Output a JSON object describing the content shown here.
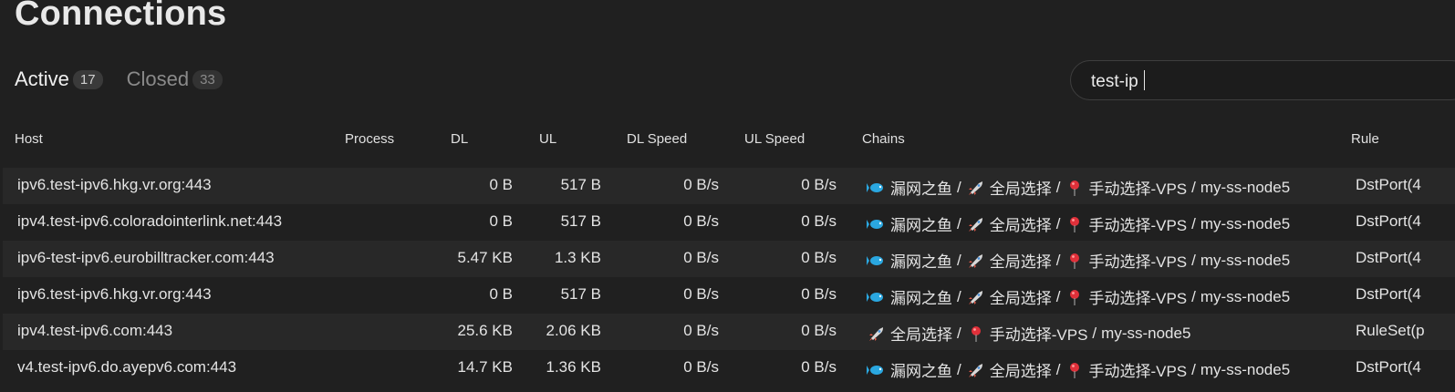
{
  "page": {
    "title": "Connections"
  },
  "tabs": [
    {
      "label": "Active",
      "count": "17"
    },
    {
      "label": "Closed",
      "count": "33"
    }
  ],
  "search": {
    "value": "test-ip",
    "placeholder": ""
  },
  "table": {
    "columns": [
      "Host",
      "Process",
      "DL",
      "UL",
      "DL Speed",
      "UL Speed",
      "Chains",
      "Rule"
    ],
    "rows": [
      {
        "host": "ipv6.test-ipv6.hkg.vr.org:443",
        "dl": "0 B",
        "ul": "517 B",
        "dl_speed": "0 B/s",
        "ul_speed": "0 B/s",
        "rule": "DstPort(4",
        "chain": [
          {
            "icon": "fish-icon",
            "label": "漏网之鱼"
          },
          {
            "icon": "rocket-icon",
            "label": "全局选择"
          },
          {
            "icon": "pin-icon",
            "label": "手动选择-VPS"
          },
          {
            "icon": "",
            "label": "my-ss-node5"
          }
        ]
      },
      {
        "host": "ipv4.test-ipv6.coloradointerlink.net:443",
        "dl": "0 B",
        "ul": "517 B",
        "dl_speed": "0 B/s",
        "ul_speed": "0 B/s",
        "rule": "DstPort(4",
        "chain": [
          {
            "icon": "fish-icon",
            "label": "漏网之鱼"
          },
          {
            "icon": "rocket-icon",
            "label": "全局选择"
          },
          {
            "icon": "pin-icon",
            "label": "手动选择-VPS"
          },
          {
            "icon": "",
            "label": "my-ss-node5"
          }
        ]
      },
      {
        "host": "ipv6-test-ipv6.eurobilltracker.com:443",
        "dl": "5.47 KB",
        "ul": "1.3 KB",
        "dl_speed": "0 B/s",
        "ul_speed": "0 B/s",
        "rule": "DstPort(4",
        "chain": [
          {
            "icon": "fish-icon",
            "label": "漏网之鱼"
          },
          {
            "icon": "rocket-icon",
            "label": "全局选择"
          },
          {
            "icon": "pin-icon",
            "label": "手动选择-VPS"
          },
          {
            "icon": "",
            "label": "my-ss-node5"
          }
        ]
      },
      {
        "host": "ipv6.test-ipv6.hkg.vr.org:443",
        "dl": "0 B",
        "ul": "517 B",
        "dl_speed": "0 B/s",
        "ul_speed": "0 B/s",
        "rule": "DstPort(4",
        "chain": [
          {
            "icon": "fish-icon",
            "label": "漏网之鱼"
          },
          {
            "icon": "rocket-icon",
            "label": "全局选择"
          },
          {
            "icon": "pin-icon",
            "label": "手动选择-VPS"
          },
          {
            "icon": "",
            "label": "my-ss-node5"
          }
        ]
      },
      {
        "host": "ipv4.test-ipv6.com:443",
        "dl": "25.6 KB",
        "ul": "2.06 KB",
        "dl_speed": "0 B/s",
        "ul_speed": "0 B/s",
        "rule": "RuleSet(p",
        "chain": [
          {
            "icon": "rocket-icon",
            "label": "全局选择"
          },
          {
            "icon": "pin-icon",
            "label": "手动选择-VPS"
          },
          {
            "icon": "",
            "label": "my-ss-node5"
          }
        ]
      },
      {
        "host": "v4.test-ipv6.do.ayepv6.com:443",
        "dl": "14.7 KB",
        "ul": "1.36 KB",
        "dl_speed": "0 B/s",
        "ul_speed": "0 B/s",
        "rule": "DstPort(4",
        "chain": [
          {
            "icon": "fish-icon",
            "label": "漏网之鱼"
          },
          {
            "icon": "rocket-icon",
            "label": "全局选择"
          },
          {
            "icon": "pin-icon",
            "label": "手动选择-VPS"
          },
          {
            "icon": "",
            "label": "my-ss-node5"
          }
        ]
      }
    ]
  },
  "colors": {
    "background": "#202020",
    "row_alt": "#282828",
    "fish": "#2aa7e0",
    "rocket": "#e05a4a",
    "pin": "#e0303a"
  }
}
